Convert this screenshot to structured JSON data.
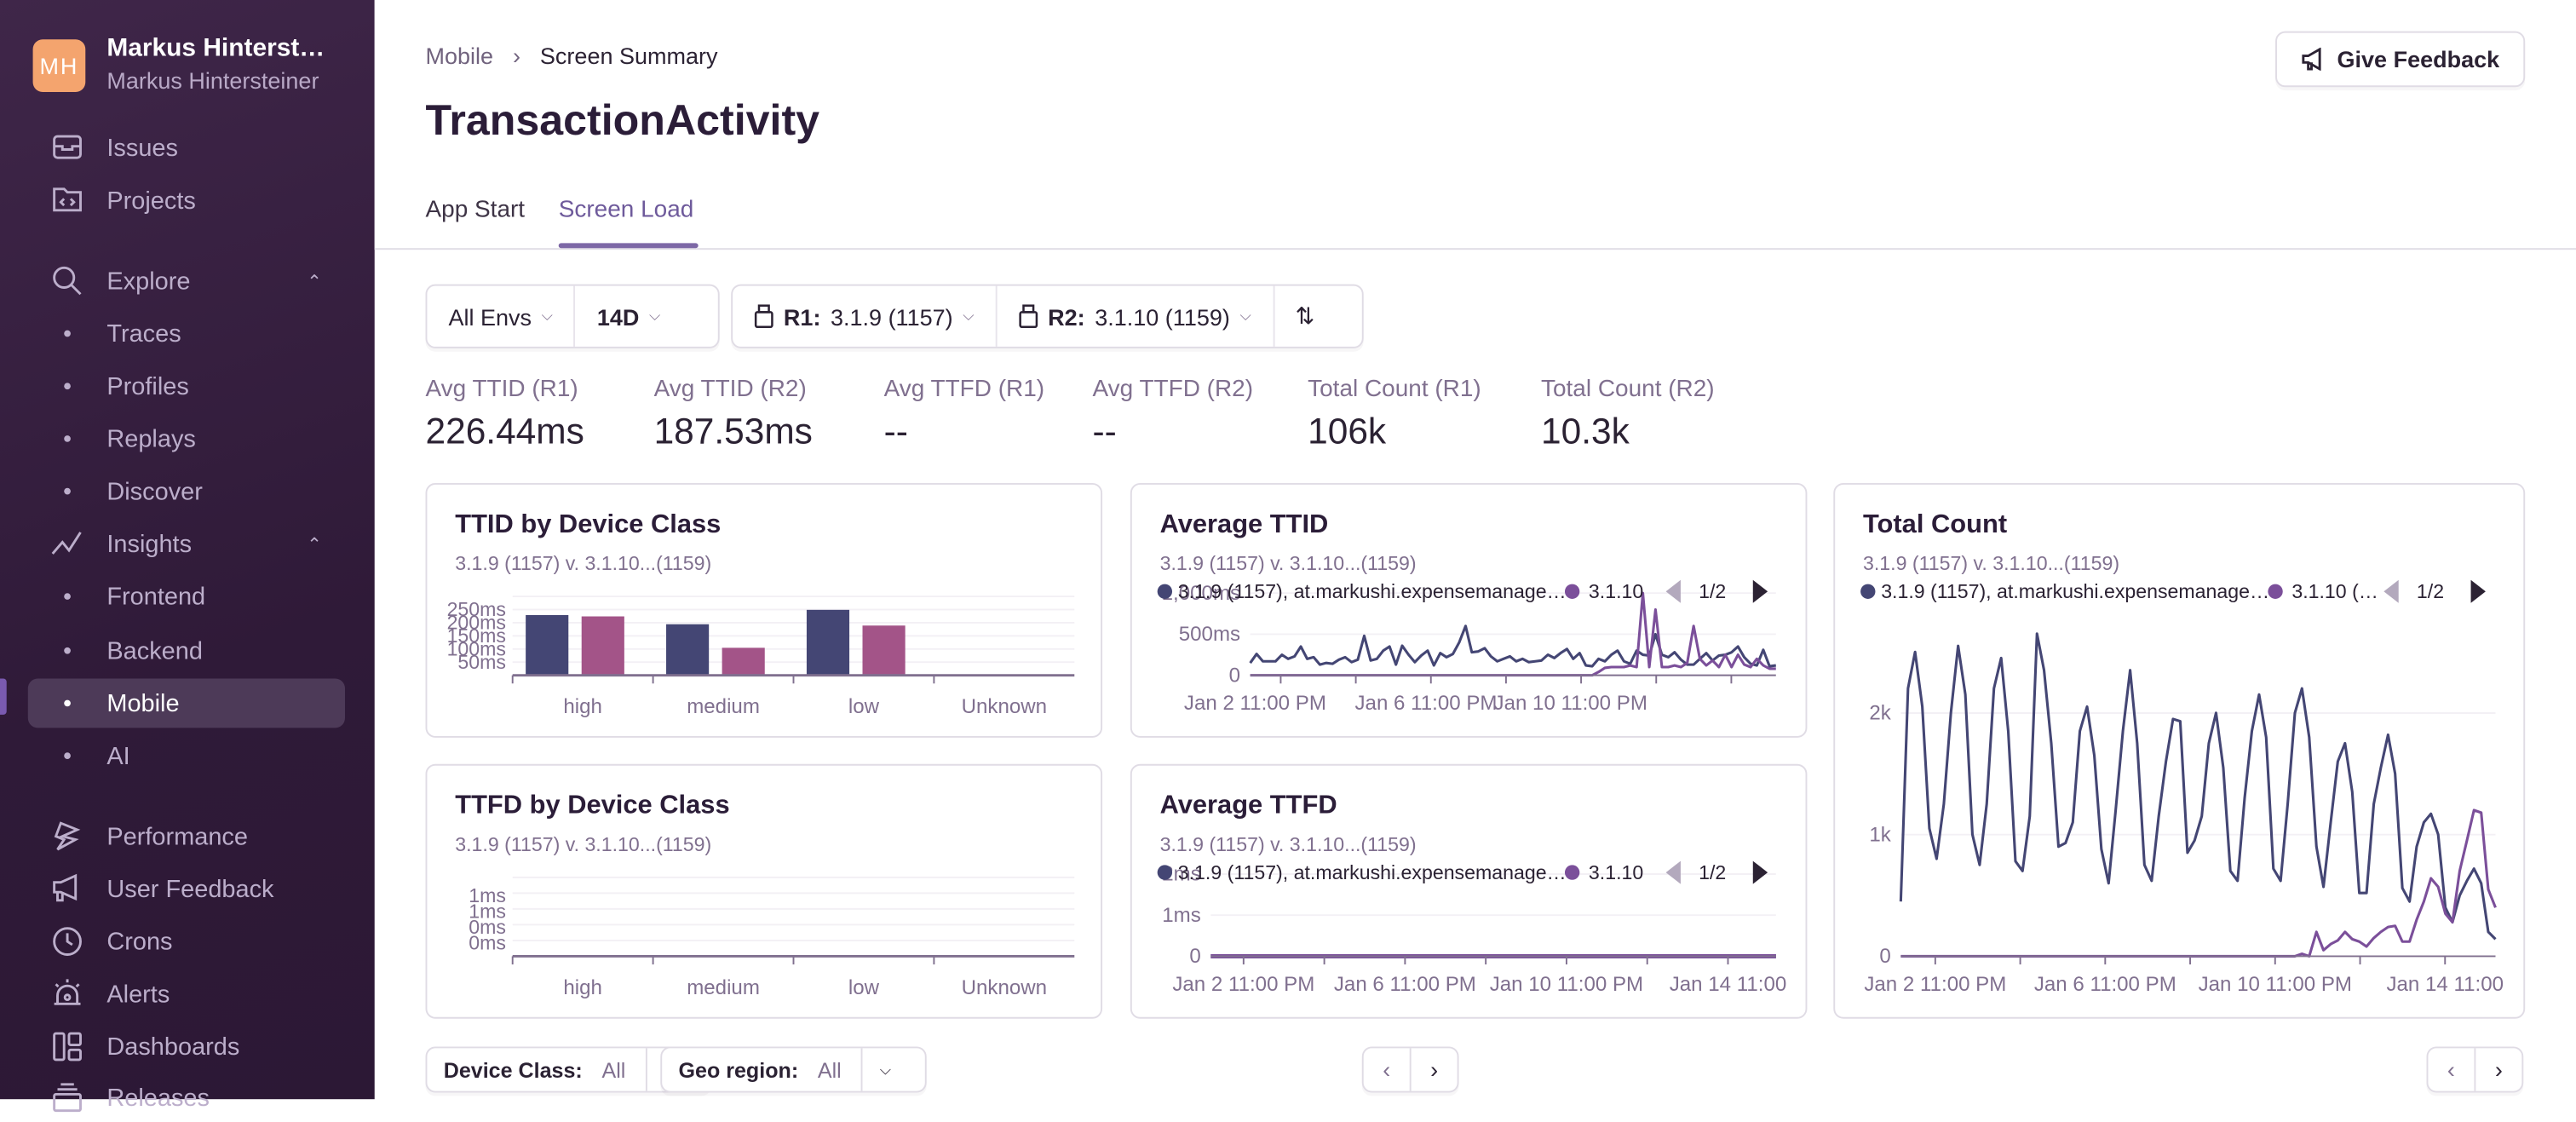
{
  "org": {
    "initials": "MH",
    "name": "Markus Hinterst…",
    "user": "Markus Hintersteiner",
    "avatar_color": "#f4a46e"
  },
  "sidebar": {
    "items": [
      {
        "label": "Issues",
        "icon": "inbox-icon"
      },
      {
        "label": "Projects",
        "icon": "code-folder-icon"
      },
      {
        "label": "Explore",
        "icon": "search-icon",
        "expanded": true
      },
      {
        "label": "Traces"
      },
      {
        "label": "Profiles"
      },
      {
        "label": "Replays"
      },
      {
        "label": "Discover"
      },
      {
        "label": "Insights",
        "icon": "graph-icon",
        "expanded": true
      },
      {
        "label": "Frontend"
      },
      {
        "label": "Backend"
      },
      {
        "label": "Mobile",
        "active": true
      },
      {
        "label": "AI"
      },
      {
        "label": "Performance",
        "icon": "lightning-icon"
      },
      {
        "label": "User Feedback",
        "icon": "megaphone-icon"
      },
      {
        "label": "Crons",
        "icon": "clock-icon"
      },
      {
        "label": "Alerts",
        "icon": "siren-icon"
      },
      {
        "label": "Dashboards",
        "icon": "dashboard-icon"
      },
      {
        "label": "Releases",
        "icon": "releases-icon"
      }
    ]
  },
  "header": {
    "breadcrumb": [
      "Mobile",
      "Screen Summary"
    ],
    "title": "TransactionActivity",
    "feedback_label": "Give Feedback",
    "tabs": [
      {
        "label": "App Start"
      },
      {
        "label": "Screen Load",
        "active": true
      }
    ]
  },
  "filters": {
    "env": "All Envs",
    "period": "14D",
    "r1_label": "R1:",
    "r1_value": "3.1.9 (1157)",
    "r2_label": "R2:",
    "r2_value": "3.1.10 (1159)"
  },
  "metrics": [
    {
      "label": "Avg TTID (R1)",
      "value": "226.44ms"
    },
    {
      "label": "Avg TTID (R2)",
      "value": "187.53ms"
    },
    {
      "label": "Avg TTFD (R1)",
      "value": "--"
    },
    {
      "label": "Avg TTFD (R2)",
      "value": "--"
    },
    {
      "label": "Total Count (R1)",
      "value": "106k"
    },
    {
      "label": "Total Count (R2)",
      "value": "10.3k"
    }
  ],
  "colors": {
    "r1": "#444674",
    "r2_bar": "#a35488",
    "r2_line": "#7b4f9a",
    "accent": "#7d68a6"
  },
  "legend": {
    "r1": "3.1.9 (1157), at.markushi.expensemanage…",
    "r2": "3.1.10",
    "r2_truncated": "3.1.10 (…",
    "page": "1/2"
  },
  "bottom": {
    "device_class_label": "Device Class:",
    "device_class_value": "All",
    "geo_label": "Geo region:",
    "geo_value": "All"
  },
  "chart_data": [
    {
      "id": "ttid-device",
      "type": "bar",
      "title": "TTID by Device Class",
      "subtitle": "3.1.9 (1157) v. 3.1.10...(1159)",
      "categories": [
        "high",
        "medium",
        "low",
        "Unknown"
      ],
      "series": [
        {
          "name": "3.1.9 (1157)",
          "values": [
            230,
            195,
            250,
            0
          ]
        },
        {
          "name": "3.1.10 (1159)",
          "values": [
            225,
            105,
            190,
            0
          ]
        }
      ],
      "yticks": [
        "50ms",
        "100ms",
        "150ms",
        "200ms",
        "250ms"
      ],
      "ylim": [
        0,
        270
      ],
      "grid": true
    },
    {
      "id": "ttfd-device",
      "type": "bar",
      "title": "TTFD by Device Class",
      "subtitle": "3.1.9 (1157) v. 3.1.10...(1159)",
      "categories": [
        "high",
        "medium",
        "low",
        "Unknown"
      ],
      "series": [
        {
          "name": "3.1.9 (1157)",
          "values": [
            0,
            0,
            0,
            0
          ]
        },
        {
          "name": "3.1.10 (1159)",
          "values": [
            0,
            0,
            0,
            0
          ]
        }
      ],
      "yticks": [
        "0ms",
        "0ms",
        "1ms",
        "1ms"
      ],
      "ylim": [
        0,
        1
      ],
      "grid": true
    },
    {
      "id": "avg-ttid",
      "type": "line",
      "title": "Average TTID",
      "subtitle": "3.1.9 (1157) v. 3.1.10...(1159)",
      "yticks": [
        "0",
        "500ms",
        "1,000ms"
      ],
      "ylim": [
        0,
        1000
      ],
      "xticks": [
        "Jan 2 11:00 PM",
        "Jan 6 11:00 PM",
        "Jan 10 11:00 PM"
      ],
      "series": [
        {
          "name": "3.1.9 (1157), at.markushi.expensemanage…",
          "values": [
            150,
            260,
            170,
            170,
            170,
            250,
            200,
            230,
            350,
            200,
            220,
            130,
            150,
            140,
            190,
            220,
            160,
            190,
            480,
            180,
            200,
            300,
            350,
            130,
            360,
            250,
            160,
            240,
            300,
            120,
            270,
            220,
            260,
            400,
            600,
            280,
            290,
            330,
            230,
            170,
            200,
            230,
            170,
            200,
            160,
            170,
            180,
            250,
            210,
            270,
            320,
            200,
            270,
            120,
            110,
            200,
            170,
            250,
            300,
            170,
            140,
            300,
            250,
            240,
            500,
            250,
            220,
            280,
            190,
            130,
            130,
            200,
            270,
            180,
            240,
            250,
            280,
            350,
            220,
            140,
            120,
            310,
            110,
            120
          ]
        },
        {
          "name": "3.1.10",
          "values": [
            0,
            0,
            0,
            0,
            0,
            0,
            0,
            0,
            0,
            0,
            0,
            0,
            0,
            0,
            0,
            0,
            0,
            0,
            0,
            0,
            0,
            0,
            0,
            0,
            0,
            0,
            0,
            0,
            0,
            0,
            0,
            0,
            0,
            0,
            0,
            0,
            0,
            0,
            0,
            0,
            0,
            0,
            0,
            0,
            0,
            0,
            0,
            0,
            0,
            0,
            0,
            0,
            0,
            0,
            0,
            40,
            90,
            100,
            100,
            100,
            120,
            100,
            1000,
            100,
            800,
            100,
            100,
            120,
            100,
            150,
            600,
            200,
            120,
            180,
            100,
            250,
            100,
            250,
            130,
            100,
            200,
            120,
            80,
            80
          ]
        }
      ]
    },
    {
      "id": "avg-ttfd",
      "type": "line",
      "title": "Average TTFD",
      "subtitle": "3.1.9 (1157) v. 3.1.10...(1159)",
      "yticks": [
        "0",
        "1ms",
        "2ms"
      ],
      "ylim": [
        0,
        2
      ],
      "xticks": [
        "Jan 2 11:00 PM",
        "Jan 6 11:00 PM",
        "Jan 10 11:00 PM",
        "Jan 14 11:00"
      ],
      "series": [
        {
          "name": "3.1.9 (1157), at.markushi.expensemanage…",
          "values": [
            0,
            0,
            0,
            0,
            0,
            0,
            0,
            0,
            0,
            0,
            0,
            0,
            0,
            0
          ]
        },
        {
          "name": "3.1.10",
          "values": [
            0,
            0,
            0,
            0,
            0,
            0,
            0,
            0,
            0,
            0,
            0,
            0,
            0,
            0
          ]
        }
      ]
    },
    {
      "id": "total-count",
      "type": "line",
      "title": "Total Count",
      "subtitle": "3.1.9 (1157) v. 3.1.10...(1159)",
      "yticks": [
        "0",
        "1k",
        "2k"
      ],
      "ylim": [
        0,
        2700
      ],
      "xticks": [
        "Jan 2 11:00 PM",
        "Jan 6 11:00 PM",
        "Jan 10 11:00 PM",
        "Jan 14 11:00"
      ],
      "series": [
        {
          "name": "3.1.9 (1157), at.markushi.expensemanage…",
          "values": [
            450,
            2200,
            2500,
            2050,
            1050,
            800,
            1250,
            2000,
            2550,
            2150,
            1000,
            750,
            1250,
            2200,
            2450,
            1850,
            780,
            700,
            1150,
            2650,
            2350,
            1750,
            900,
            930,
            1100,
            1850,
            2050,
            1650,
            880,
            600,
            1200,
            1850,
            2350,
            1750,
            750,
            620,
            1150,
            1600,
            1950,
            1930,
            850,
            950,
            1150,
            1750,
            2000,
            1550,
            700,
            620,
            1300,
            1850,
            2150,
            1800,
            720,
            620,
            1250,
            2000,
            2200,
            1800,
            900,
            570,
            1100,
            1600,
            1750,
            1350,
            520,
            520,
            1250,
            1550,
            1820,
            1500,
            560,
            450,
            900,
            1100,
            1170,
            1000,
            400,
            280,
            500,
            620,
            720,
            600,
            200,
            140
          ]
        },
        {
          "name": "3.1.10 (1159)",
          "values": [
            0,
            0,
            0,
            0,
            0,
            0,
            0,
            0,
            0,
            0,
            0,
            0,
            0,
            0,
            0,
            0,
            0,
            0,
            0,
            0,
            0,
            0,
            0,
            0,
            0,
            0,
            0,
            0,
            0,
            0,
            0,
            0,
            0,
            0,
            0,
            0,
            0,
            0,
            0,
            0,
            0,
            0,
            0,
            0,
            0,
            0,
            0,
            0,
            0,
            0,
            0,
            0,
            0,
            0,
            0,
            0,
            20,
            0,
            200,
            50,
            100,
            130,
            200,
            140,
            120,
            80,
            150,
            200,
            240,
            250,
            120,
            120,
            300,
            450,
            640,
            570,
            350,
            280,
            700,
            950,
            1200,
            1180,
            550,
            400
          ]
        }
      ]
    }
  ]
}
